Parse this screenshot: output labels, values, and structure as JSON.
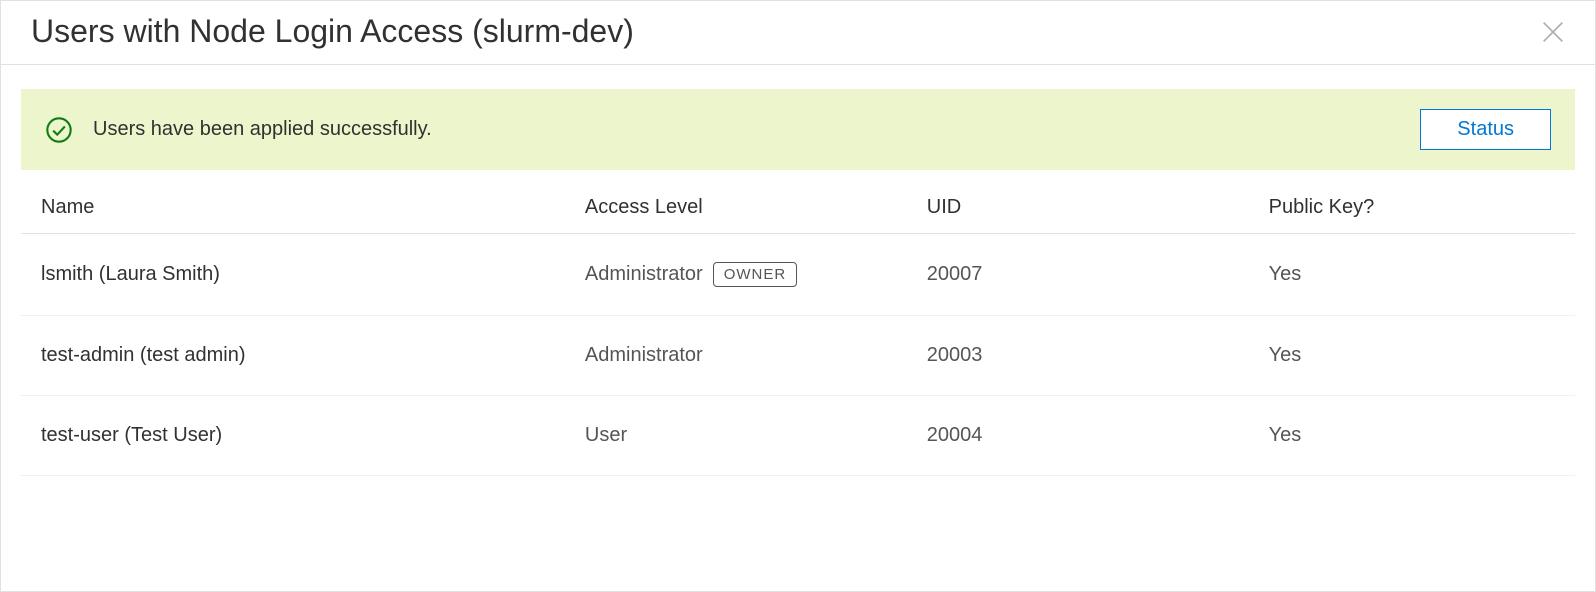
{
  "header": {
    "title": "Users with Node Login Access (slurm-dev)"
  },
  "notification": {
    "message": "Users have been applied successfully.",
    "status_button_label": "Status"
  },
  "table": {
    "columns": {
      "name": "Name",
      "access_level": "Access Level",
      "uid": "UID",
      "public_key": "Public Key?"
    },
    "rows": [
      {
        "name": "lsmith (Laura Smith)",
        "access_level": "Administrator",
        "owner_badge": "OWNER",
        "uid": "20007",
        "public_key": "Yes"
      },
      {
        "name": "test-admin (test admin)",
        "access_level": "Administrator",
        "owner_badge": "",
        "uid": "20003",
        "public_key": "Yes"
      },
      {
        "name": "test-user (Test User)",
        "access_level": "User",
        "owner_badge": "",
        "uid": "20004",
        "public_key": "Yes"
      }
    ]
  }
}
